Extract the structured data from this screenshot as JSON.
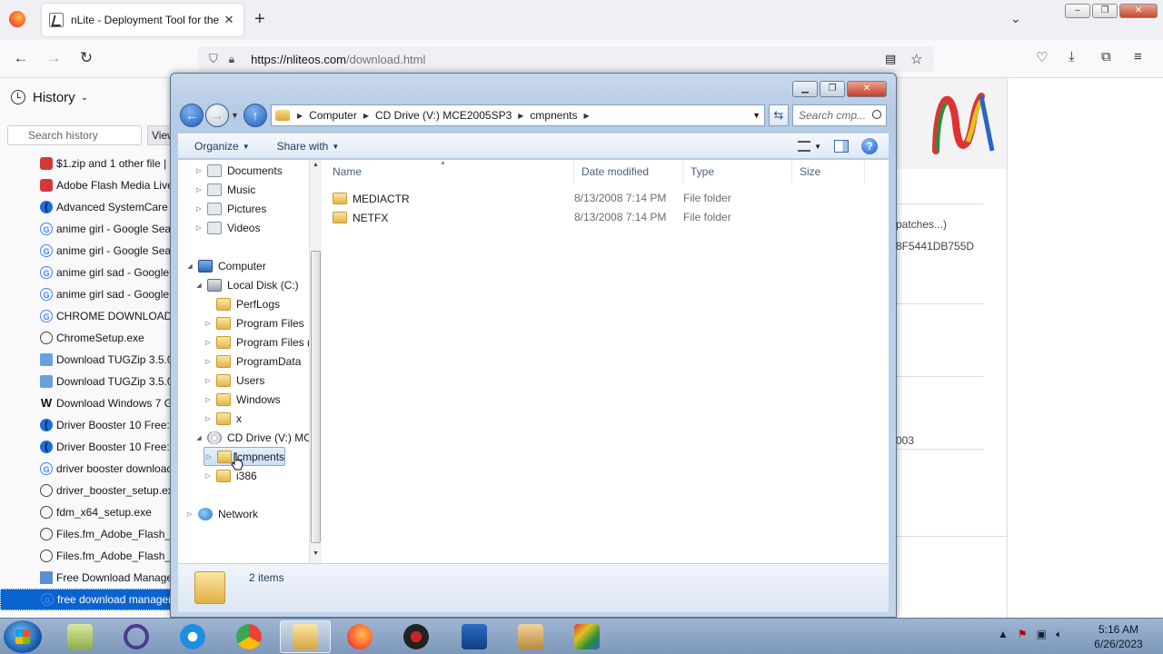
{
  "browser": {
    "tab_title": "nLite - Deployment Tool for the",
    "new_tab": "+",
    "url_host": "https://nliteos.com",
    "url_path": "/download.html",
    "list_all_tabs": "⌄",
    "window_minimize": "–",
    "window_restore": "❐",
    "window_close": "✕"
  },
  "sidebar": {
    "title": "History",
    "search_placeholder": "Search history",
    "view_button": "View",
    "items": [
      {
        "label": "$1.zip and 1 other file | F",
        "icon": "red"
      },
      {
        "label": "Adobe Flash Media Live",
        "icon": "red"
      },
      {
        "label": "Advanced SystemCare F",
        "icon": "blue"
      },
      {
        "label": "anime girl - Google Sear",
        "icon": "g"
      },
      {
        "label": "anime girl - Google Sear",
        "icon": "g"
      },
      {
        "label": "anime girl sad - Google",
        "icon": "g"
      },
      {
        "label": "anime girl sad - Google",
        "icon": "g"
      },
      {
        "label": "CHROME DOWNLOAD",
        "icon": "g"
      },
      {
        "label": "ChromeSetup.exe",
        "icon": "web"
      },
      {
        "label": "Download TUGZip 3.5.0",
        "icon": "tug"
      },
      {
        "label": "Download TUGZip 3.5.0",
        "icon": "tug"
      },
      {
        "label": "Download Windows 7 G",
        "icon": "w"
      },
      {
        "label": "Driver Booster 10 Free: C",
        "icon": "blue"
      },
      {
        "label": "Driver Booster 10 Free: C",
        "icon": "blue"
      },
      {
        "label": "driver booster downloac",
        "icon": "g"
      },
      {
        "label": "driver_booster_setup.exe",
        "icon": "web"
      },
      {
        "label": "fdm_x64_setup.exe",
        "icon": "web"
      },
      {
        "label": "Files.fm_Adobe_Flash_M",
        "icon": "web"
      },
      {
        "label": "Files.fm_Adobe_Flash_M",
        "icon": "web"
      },
      {
        "label": "Free Download Manage",
        "icon": "fdm"
      },
      {
        "label": "free download manager",
        "icon": "g",
        "selected": true
      }
    ]
  },
  "page": {
    "text1": "patches...)",
    "text2": "8F5441DB755D",
    "text3": "003"
  },
  "explorer": {
    "breadcrumb": [
      "Computer",
      "CD Drive (V:) MCE2005SP3",
      "cmpnents"
    ],
    "search_placeholder": "Search cmp...",
    "toolbar": {
      "organize": "Organize",
      "share_with": "Share with"
    },
    "tree": [
      {
        "label": "Documents",
        "icon": "lib",
        "indent": 1,
        "exp": "▷"
      },
      {
        "label": "Music",
        "icon": "lib",
        "indent": 1,
        "exp": "▷"
      },
      {
        "label": "Pictures",
        "icon": "lib",
        "indent": 1,
        "exp": "▷"
      },
      {
        "label": "Videos",
        "icon": "lib",
        "indent": 1,
        "exp": "▷"
      },
      {
        "label": "Computer",
        "icon": "pc",
        "indent": 0,
        "exp": "◢"
      },
      {
        "label": "Local Disk (C:)",
        "icon": "drv",
        "indent": 1,
        "exp": "◢"
      },
      {
        "label": "PerfLogs",
        "icon": "fold",
        "indent": 2,
        "exp": ""
      },
      {
        "label": "Program Files",
        "icon": "fold",
        "indent": 2,
        "exp": "▷"
      },
      {
        "label": "Program Files (",
        "icon": "fold",
        "indent": 2,
        "exp": "▷"
      },
      {
        "label": "ProgramData",
        "icon": "fold",
        "indent": 2,
        "exp": "▷"
      },
      {
        "label": "Users",
        "icon": "fold",
        "indent": 2,
        "exp": "▷"
      },
      {
        "label": "Windows",
        "icon": "fold",
        "indent": 2,
        "exp": "▷"
      },
      {
        "label": "x",
        "icon": "fold",
        "indent": 2,
        "exp": "▷"
      },
      {
        "label": "CD Drive (V:) MC",
        "icon": "cd",
        "indent": 1,
        "exp": "◢"
      },
      {
        "label": "cmpnents",
        "icon": "fold",
        "indent": 2,
        "exp": "▷",
        "selected": true
      },
      {
        "label": "i386",
        "icon": "fold",
        "indent": 2,
        "exp": "▷"
      },
      {
        "label": "Network",
        "icon": "net",
        "indent": 0,
        "exp": "▷"
      }
    ],
    "columns": {
      "name": "Name",
      "date": "Date modified",
      "type": "Type",
      "size": "Size"
    },
    "files": [
      {
        "name": "MEDIACTR",
        "date": "8/13/2008 7:14 PM",
        "type": "File folder",
        "size": ""
      },
      {
        "name": "NETFX",
        "date": "8/13/2008 7:14 PM",
        "type": "File folder",
        "size": ""
      }
    ],
    "status": "2 items"
  },
  "taskbar": {
    "time": "5:16 AM",
    "date": "6/26/2023"
  }
}
